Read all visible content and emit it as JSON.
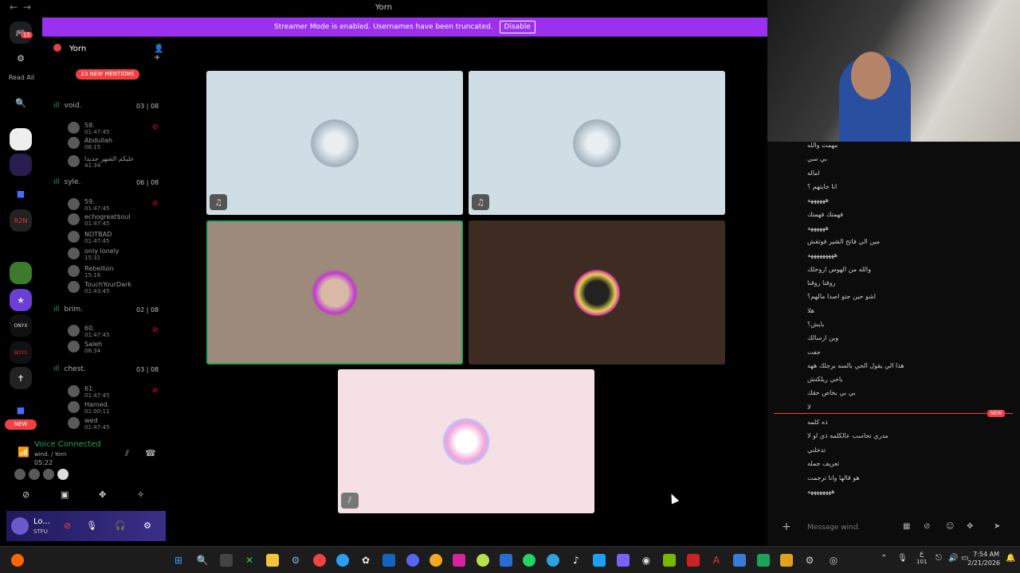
{
  "window": {
    "title": "Yorn",
    "back": "←",
    "forward": "→"
  },
  "banner": {
    "text": "Streamer Mode is enabled. Usernames have been truncated.",
    "button": "Disable"
  },
  "rail": {
    "badge": "15",
    "read_all": "Read All",
    "new_label": "NEW"
  },
  "server": {
    "name": "Yorn",
    "mentions": "23 NEW MENTIONS"
  },
  "channels": [
    {
      "name": "void.",
      "count": "03 | 08",
      "users": [
        {
          "name": "58.",
          "time": "01:47:45"
        },
        {
          "name": "Abdullah",
          "time": "06:15"
        },
        {
          "name": "عليكم الشهر جديدا",
          "time": "41:34"
        }
      ]
    },
    {
      "name": "syle.",
      "count": "06 | 08",
      "users": [
        {
          "name": "59.",
          "time": "01:47:45"
        },
        {
          "name": "echogreat$oul",
          "time": "01:47:45"
        },
        {
          "name": "NOTBAD",
          "time": "01:47:45"
        },
        {
          "name": "only lonely",
          "time": "15:31"
        },
        {
          "name": "Rebellion",
          "time": "15:16"
        },
        {
          "name": "TouchYourDark",
          "time": "01:43:45"
        }
      ]
    },
    {
      "name": "brim.",
      "count": "02 | 08",
      "users": [
        {
          "name": "60.",
          "time": "01:47:45"
        },
        {
          "name": "Saleh",
          "time": "06:34"
        }
      ]
    },
    {
      "name": "chest.",
      "count": "03 | 08",
      "users": [
        {
          "name": "61.",
          "time": "01:47:45"
        },
        {
          "name": "Hamed.",
          "time": "01:00:11"
        },
        {
          "name": "wed",
          "time": "01:47:45"
        }
      ]
    }
  ],
  "voice": {
    "status": "Voice Connected",
    "location": "wind. / Yorn",
    "time": "05:22"
  },
  "user": {
    "name": "Lo...",
    "status": "STFU"
  },
  "chat": {
    "messages_before": [
      "مهمت والله",
      "بي سي",
      "اماله",
      "انا جايتهم ؟",
      "ههههههه",
      "فهمتك فهمتك",
      "ههههههه",
      "مين الي فاتح الشير فوتقش",
      "هههههههههه",
      "والله من الهوس اروحلك",
      "روقنا روقنا",
      "اشو حين جتو اصدا مالهم؟",
      "هلا",
      "بايش؟",
      "وين ارسالك",
      "جفت",
      "هذا الي يقول الحي بالسه برجلك ههه",
      "ياخي ريلكتش",
      "بي بي بخاص حقك",
      "لا"
    ],
    "new_tag": "NEW",
    "messages_after": [
      "ذه كلمه",
      "مدري تحاسب عالكلمه ذي او لا",
      "تدخلني",
      "تعريف جمله",
      "هو قالها وانا ترجمت",
      "ههههههههه"
    ],
    "placeholder": "Message wind."
  },
  "taskbar": {
    "time": "7:54 AM",
    "date": "2/21/2026",
    "lang": "ع",
    "mic_level": "101"
  },
  "colors": {
    "accent": "#9b30f0",
    "green": "#23a55a",
    "red": "#f23f43"
  }
}
